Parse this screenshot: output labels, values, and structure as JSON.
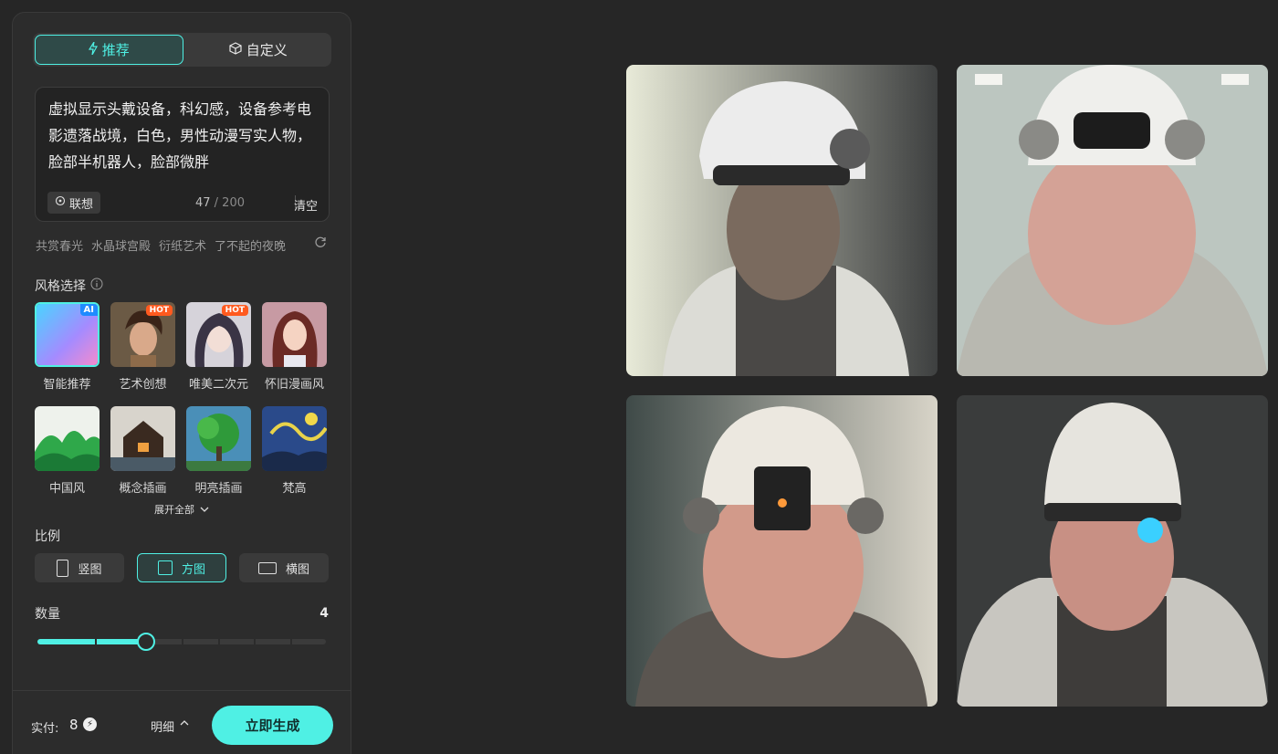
{
  "tabs": [
    {
      "label": "推荐",
      "icon": "lightning-icon",
      "active": true
    },
    {
      "label": "自定义",
      "icon": "cube-icon",
      "active": false
    }
  ],
  "prompt": {
    "text": "虚拟显示头戴设备，科幻感，设备参考电影遗落战境，白色，男性动漫写实人物，脸部半机器人，脸部微胖",
    "lianxiang_label": "联想",
    "char_count": "47",
    "char_max": "/ 200",
    "clear_label": "清空"
  },
  "suggestions": [
    "共赏春光",
    "水晶球宫殿",
    "衍纸艺术",
    "了不起的夜晚"
  ],
  "style_section": {
    "title": "风格选择",
    "items": [
      {
        "label": "智能推荐",
        "badge": "AI",
        "selected": true
      },
      {
        "label": "艺术创想",
        "badge": "HOT",
        "selected": false
      },
      {
        "label": "唯美二次元",
        "badge": "HOT",
        "selected": false
      },
      {
        "label": "怀旧漫画风",
        "badge": "",
        "selected": false
      },
      {
        "label": "中国风",
        "badge": "",
        "selected": false
      },
      {
        "label": "概念插画",
        "badge": "",
        "selected": false
      },
      {
        "label": "明亮插画",
        "badge": "",
        "selected": false
      },
      {
        "label": "梵高",
        "badge": "",
        "selected": false
      }
    ],
    "expand_label": "展开全部"
  },
  "ratio_section": {
    "title": "比例",
    "options": [
      {
        "label": "竖图",
        "shape": "portrait",
        "active": false
      },
      {
        "label": "方图",
        "shape": "square",
        "active": true
      },
      {
        "label": "横图",
        "shape": "landscape",
        "active": false
      }
    ]
  },
  "count_section": {
    "title": "数量",
    "value": "4",
    "slider_fraction": 0.375
  },
  "footer": {
    "pay_label": "实付:",
    "pay_value": "8",
    "detail_label": "明细",
    "generate_label": "立即生成"
  },
  "colors": {
    "accent": "#4ff0e4",
    "panel": "#2c2c2c",
    "background": "#262626",
    "hot_badge": "#ff5a1f"
  }
}
